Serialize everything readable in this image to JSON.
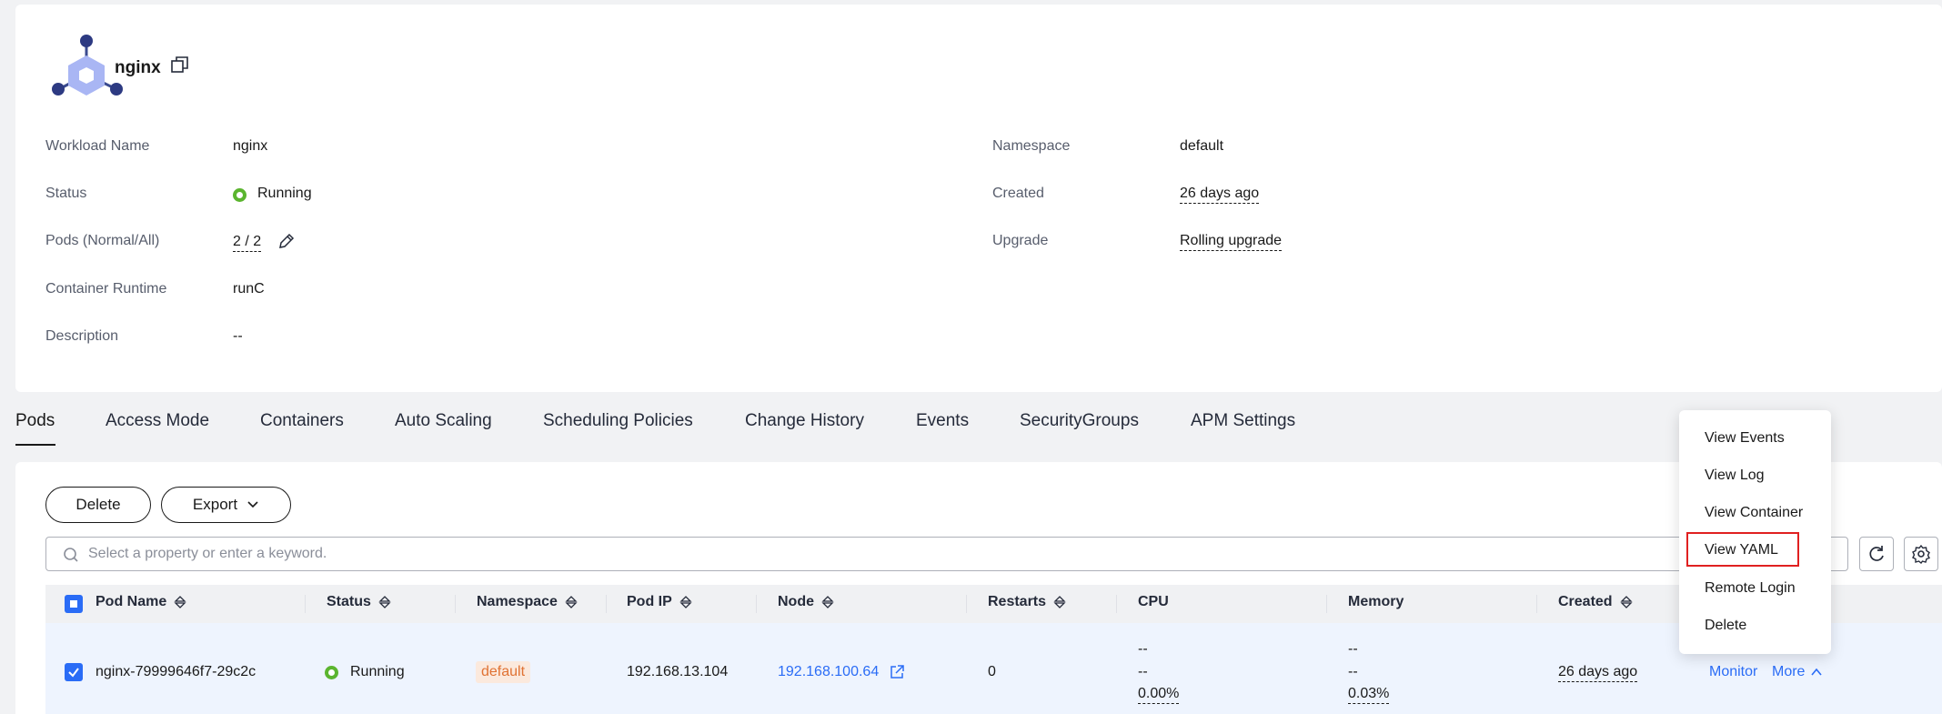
{
  "header": {
    "title": "nginx"
  },
  "info": {
    "workload_name_label": "Workload Name",
    "workload_name": "nginx",
    "status_label": "Status",
    "status": "Running",
    "pods_label": "Pods (Normal/All)",
    "pods": "2 / 2",
    "runtime_label": "Container Runtime",
    "runtime": "runC",
    "description_label": "Description",
    "description": "--",
    "namespace_label": "Namespace",
    "namespace": "default",
    "created_label": "Created",
    "created": "26 days ago",
    "upgrade_label": "Upgrade",
    "upgrade": "Rolling upgrade"
  },
  "tabs": [
    "Pods",
    "Access Mode",
    "Containers",
    "Auto Scaling",
    "Scheduling Policies",
    "Change History",
    "Events",
    "SecurityGroups",
    "APM Settings"
  ],
  "toolbar": {
    "delete_label": "Delete",
    "export_label": "Export"
  },
  "search": {
    "placeholder": "Select a property or enter a keyword."
  },
  "table": {
    "columns": [
      "Pod Name",
      "Status",
      "Namespace",
      "Pod IP",
      "Node",
      "Restarts",
      "CPU",
      "Memory",
      "Created"
    ],
    "rows": [
      {
        "pod_name": "nginx-79999646f7-29c2c",
        "status": "Running",
        "namespace": "default",
        "pod_ip": "192.168.13.104",
        "node": "192.168.100.64",
        "restarts": "0",
        "cpu_line1": "--",
        "cpu_line2": "--",
        "cpu_pct": "0.00%",
        "mem_line1": "--",
        "mem_line2": "--",
        "mem_pct": "0.03%",
        "created": "26 days ago",
        "monitor": "Monitor",
        "more": "More"
      }
    ]
  },
  "menu": {
    "items": [
      "View Events",
      "View Log",
      "View Container",
      "View YAML",
      "Remote Login",
      "Delete"
    ],
    "highlighted": "View YAML"
  },
  "colors": {
    "accent": "#2a6cf6",
    "running": "#5bb52f",
    "highlight_box": "#e02020",
    "tag_bg": "#fbe9dd",
    "tag_text": "#e07233"
  }
}
